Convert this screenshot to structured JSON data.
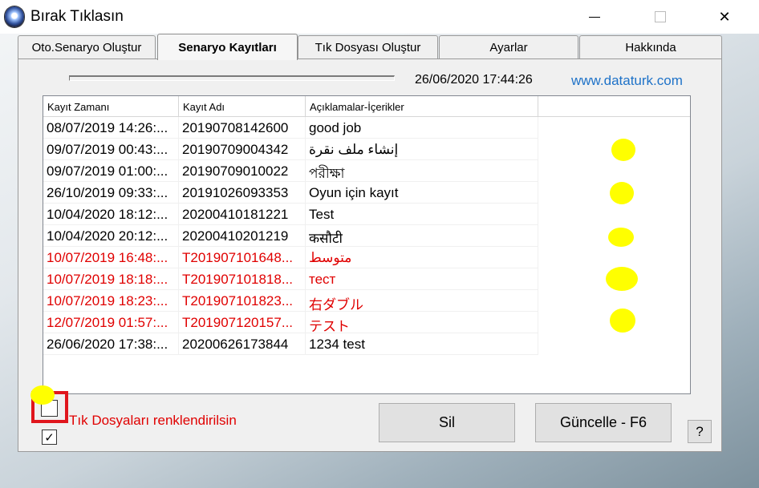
{
  "window": {
    "title": "Bırak Tıklasın",
    "minimize_glyph": "",
    "maximize_glyph": "",
    "close_glyph": "✕"
  },
  "tabs": [
    {
      "label": "Oto.Senaryo Oluştur",
      "active": false
    },
    {
      "label": "Senaryo Kayıtları",
      "active": true
    },
    {
      "label": "Tık Dosyası Oluştur",
      "active": false
    },
    {
      "label": "Ayarlar",
      "active": false
    },
    {
      "label": "Hakkında",
      "active": false
    }
  ],
  "status": {
    "progress_percent": 0,
    "datetime": "26/06/2020 17:44:26",
    "website": "www.dataturk.com"
  },
  "list": {
    "columns": [
      "Kayıt Zamanı",
      "Kayıt Adı",
      "Açıklamalar-İçerikler"
    ],
    "rows": [
      {
        "time": "08/07/2019 14:26:...",
        "name": "20190708142600",
        "desc": "good job",
        "red": false
      },
      {
        "time": "09/07/2019 00:43:...",
        "name": "20190709004342",
        "desc": "إنشاء ملف نقرة",
        "red": false
      },
      {
        "time": "09/07/2019 01:00:...",
        "name": "20190709010022",
        "desc": "পরীক্ষা",
        "red": false
      },
      {
        "time": "26/10/2019 09:33:...",
        "name": "20191026093353",
        "desc": "Oyun için kayıt",
        "red": false
      },
      {
        "time": "10/04/2020 18:12:...",
        "name": "20200410181221",
        "desc": "Test",
        "red": false
      },
      {
        "time": "10/04/2020 20:12:...",
        "name": "20200410201219",
        "desc": " कसौटी",
        "red": false
      },
      {
        "time": "10/07/2019 16:48:...",
        "name": "T201907101648...",
        "desc": "متوسط",
        "red": true
      },
      {
        "time": "10/07/2019 18:18:...",
        "name": "T201907101818...",
        "desc": "тест",
        "red": true
      },
      {
        "time": "10/07/2019 18:23:...",
        "name": "T201907101823...",
        "desc": "右ダブル",
        "red": true
      },
      {
        "time": "12/07/2019 01:57:...",
        "name": "T201907120157...",
        "desc": "テスト",
        "red": true
      },
      {
        "time": "26/06/2020 17:38:...",
        "name": "20200626173844",
        "desc": "1234 test",
        "red": false
      }
    ]
  },
  "annotation_colors": {
    "highlight": "#ffff00",
    "box": "#e0161d"
  },
  "options": {
    "colorize_label": "Tık Dosyaları renklendirilsin",
    "colorize_checked": false,
    "second_checked": true,
    "check_glyph": "✓"
  },
  "buttons": {
    "delete": "Sil",
    "refresh": "Güncelle - F6",
    "help": "?"
  }
}
